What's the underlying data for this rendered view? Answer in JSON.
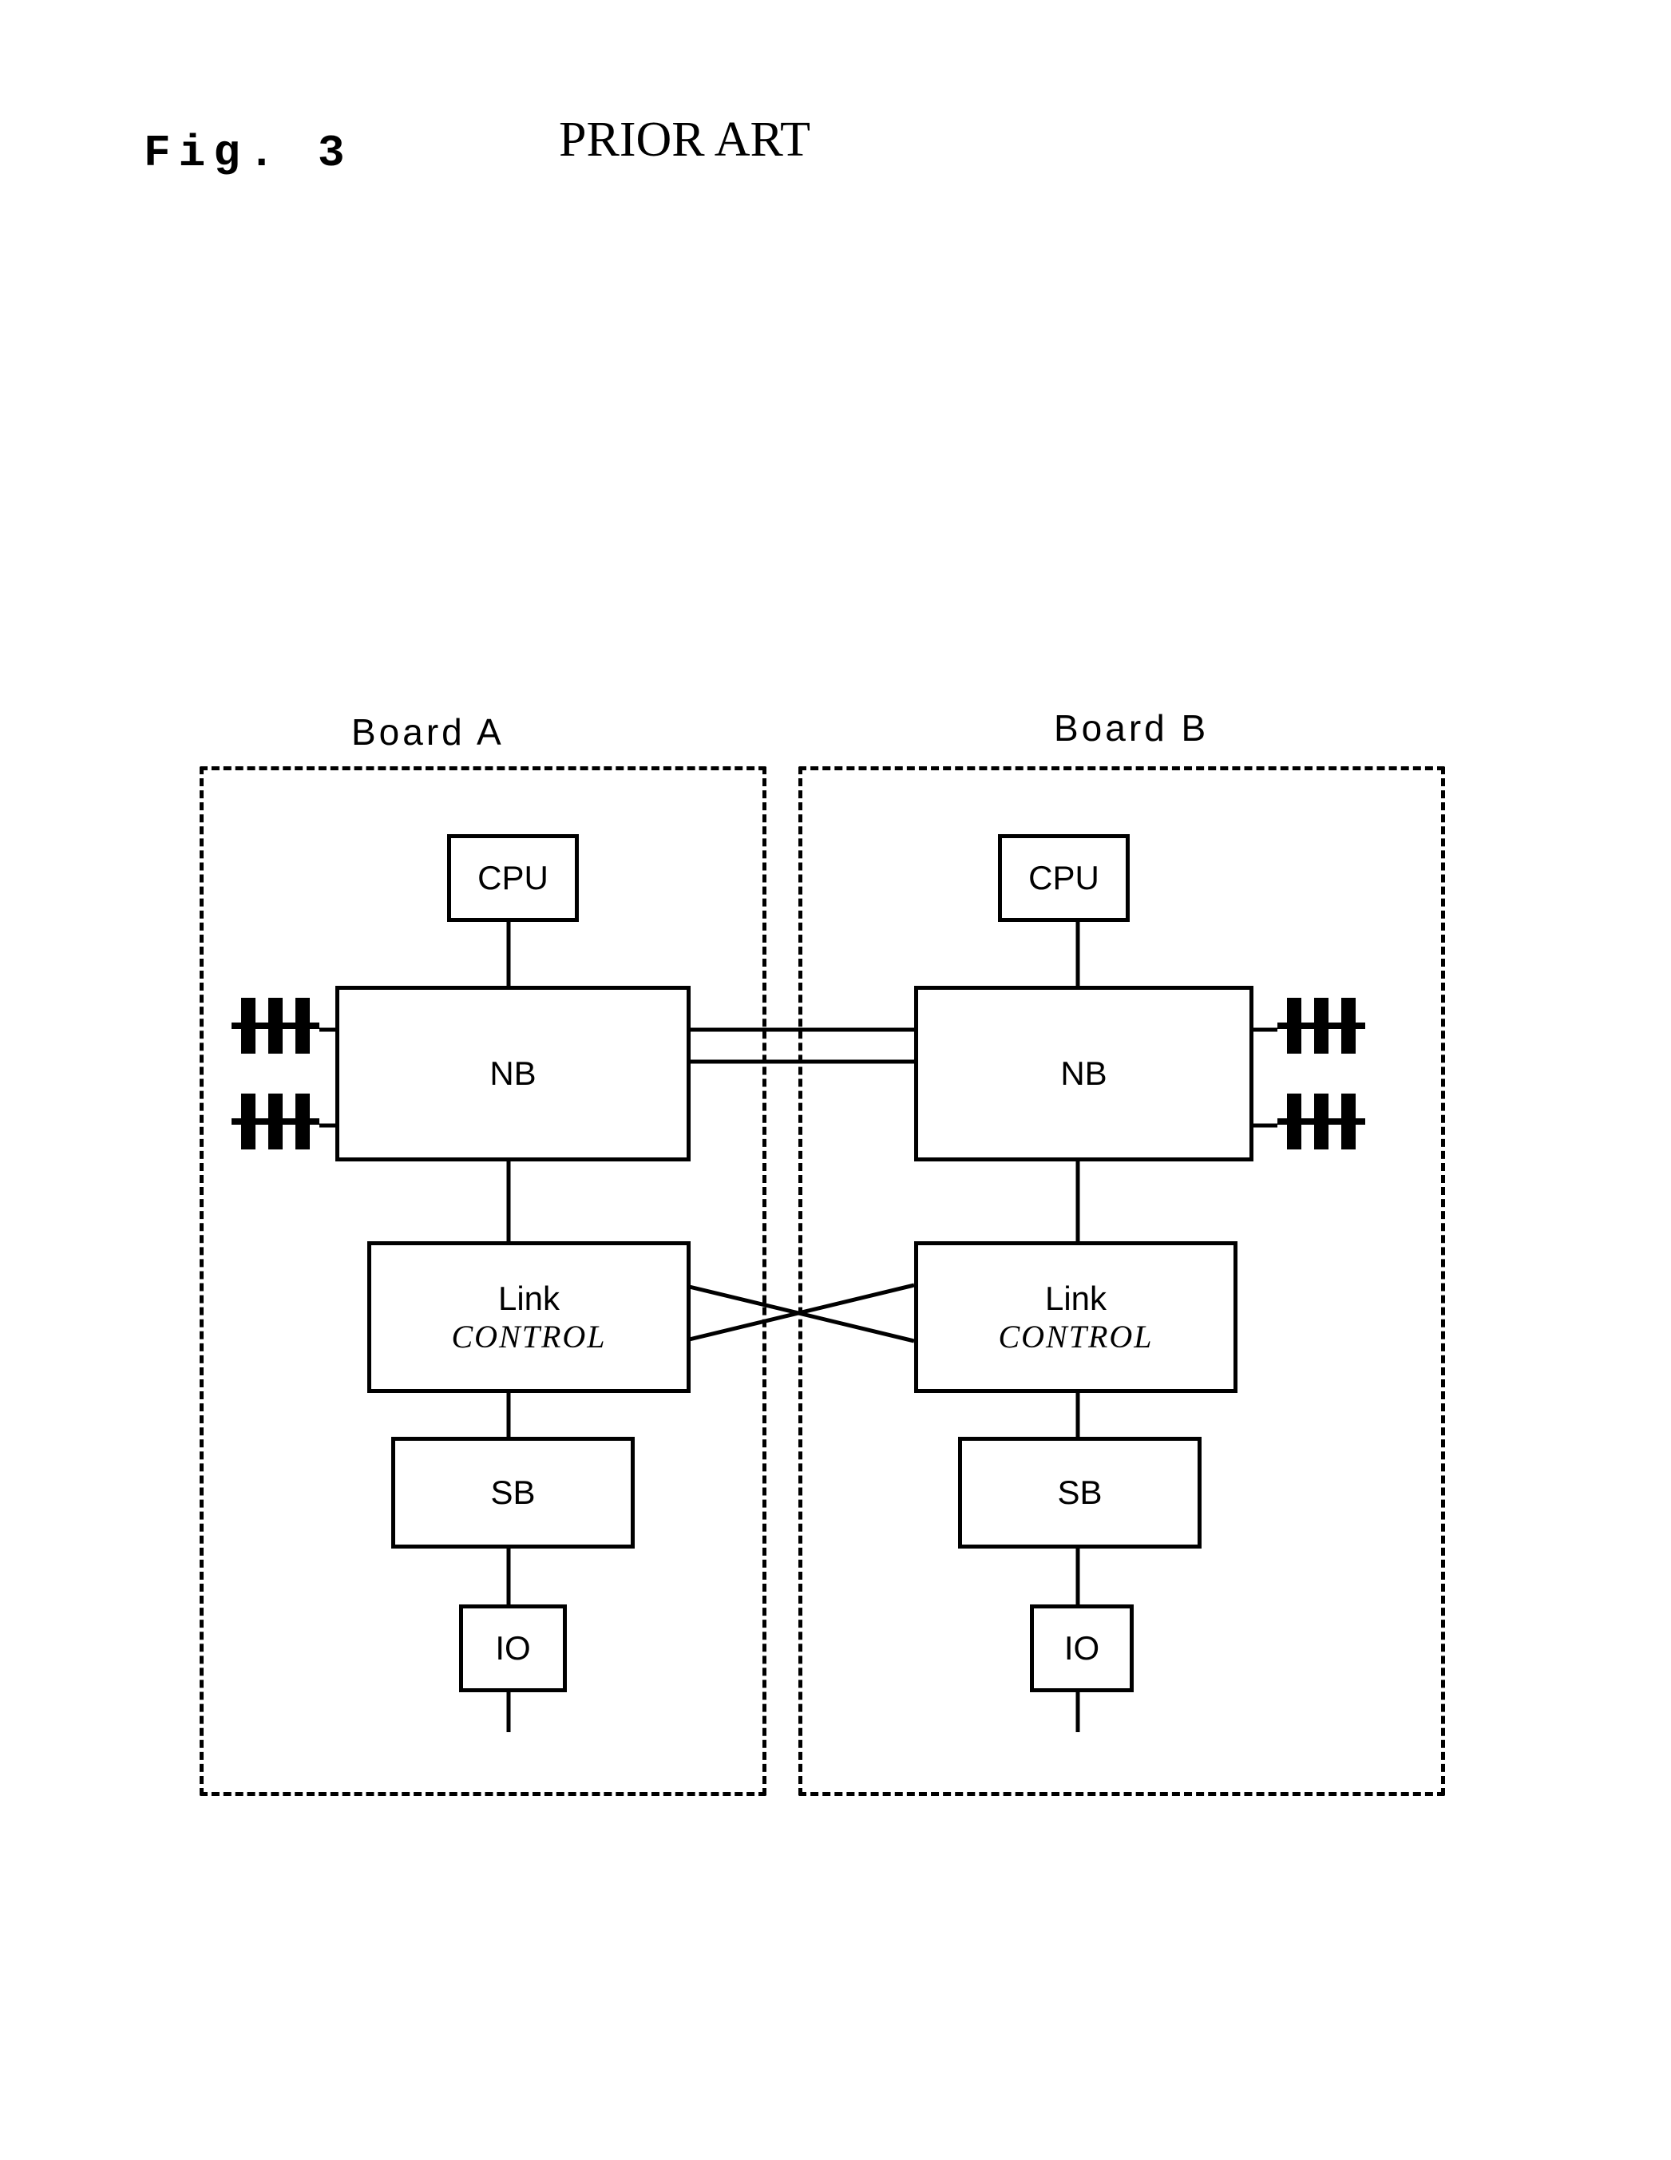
{
  "figure_label": "Fig. 3",
  "prior_art": "PRIOR ART",
  "boards": {
    "a": {
      "title": "Board  A",
      "cpu": "CPU",
      "nb": "NB",
      "link1": "Link",
      "link2": "CONTROL",
      "sb": "SB",
      "io": "IO"
    },
    "b": {
      "title": "Board  B",
      "cpu": "CPU",
      "nb": "NB",
      "link1": "Link",
      "link2": "CONTROL",
      "sb": "SB",
      "io": "IO"
    }
  }
}
